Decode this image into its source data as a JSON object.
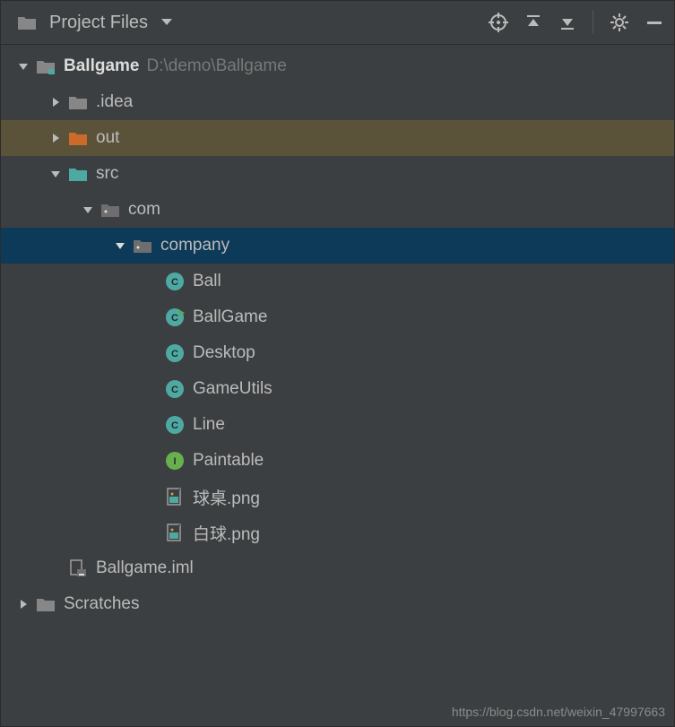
{
  "header": {
    "title": "Project Files"
  },
  "project": {
    "name": "Ballgame",
    "path": "D:\\demo\\Ballgame"
  },
  "nodes": {
    "idea": ".idea",
    "out": "out",
    "src": "src",
    "com": "com",
    "company": "company",
    "ball": "Ball",
    "ballgame": "BallGame",
    "desktop": "Desktop",
    "gameutils": "GameUtils",
    "line": "Line",
    "paintable": "Paintable",
    "img1": "球桌.png",
    "img2": "白球.png",
    "iml": "Ballgame.iml",
    "scratches": "Scratches"
  },
  "watermark": "https://blog.csdn.net/weixin_47997663"
}
